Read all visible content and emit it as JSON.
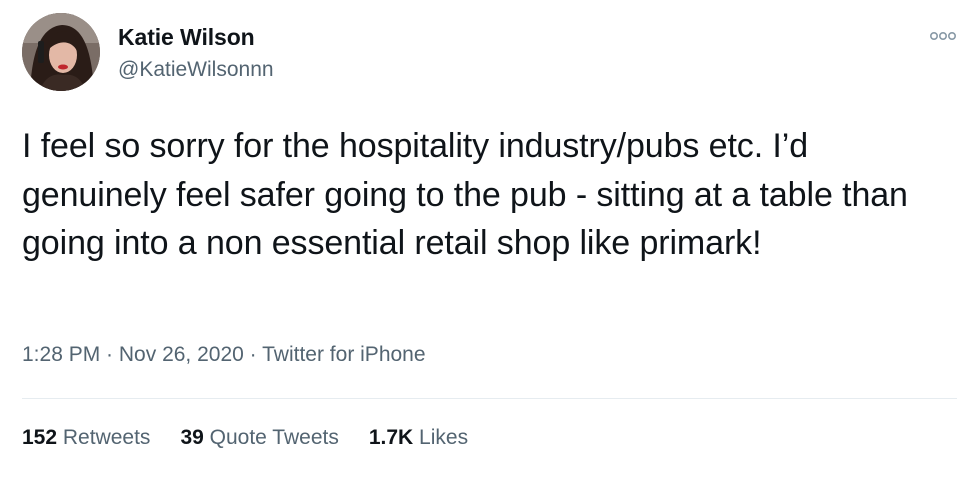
{
  "tweet": {
    "display_name": "Katie Wilson",
    "handle": "@KatieWilsonnn",
    "text": "I feel so sorry for the hospitality industry/pubs etc. I’d genuinely feel safer going to the pub - sitting at a table than going into a non essential retail shop like primark!",
    "time": "1:28 PM",
    "separator": " · ",
    "date": "Nov 26, 2020",
    "source": "Twitter for iPhone",
    "stats": {
      "retweets_count": "152",
      "retweets_label": "Retweets",
      "quote_count": "39",
      "quote_label": "Quote Tweets",
      "likes_count": "1.7K",
      "likes_label": "Likes"
    }
  },
  "icons": {
    "more": "more-horizontal-icon",
    "avatar": "profile-photo"
  },
  "colors": {
    "text_primary": "#0f1419",
    "text_secondary": "#536471",
    "divider": "#e6ecf0"
  }
}
